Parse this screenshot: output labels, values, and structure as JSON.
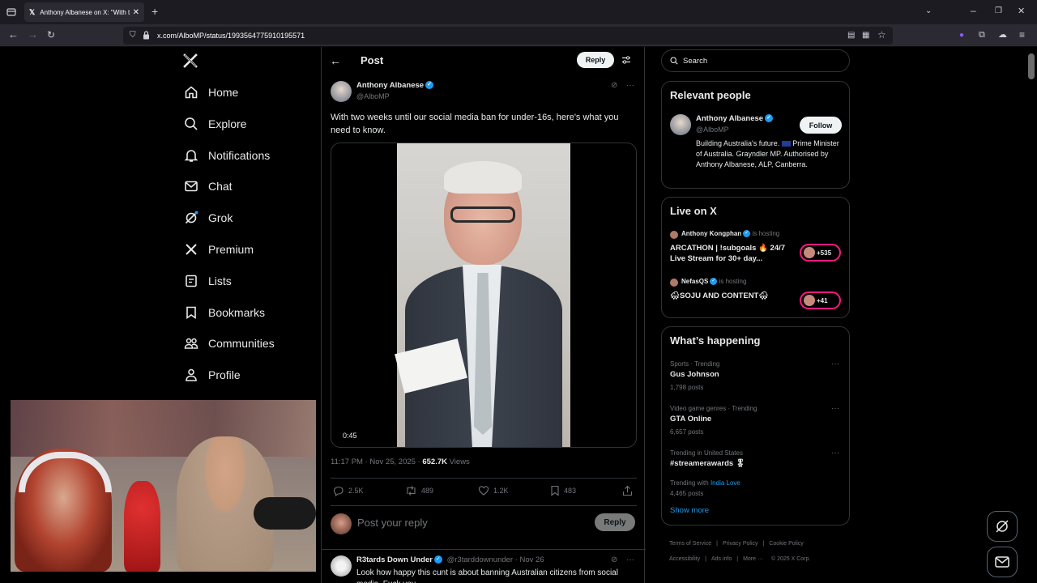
{
  "browser": {
    "tab_title": "Anthony Albanese on X: \"With t",
    "url": "x.com/AlboMP/status/1993564775910195571"
  },
  "nav": {
    "items": [
      {
        "label": "Home",
        "icon": "home-icon"
      },
      {
        "label": "Explore",
        "icon": "search-icon"
      },
      {
        "label": "Notifications",
        "icon": "bell-icon"
      },
      {
        "label": "Chat",
        "icon": "mail-icon"
      },
      {
        "label": "Grok",
        "icon": "grok-icon"
      },
      {
        "label": "Premium",
        "icon": "x-logo-icon"
      },
      {
        "label": "Lists",
        "icon": "list-icon"
      },
      {
        "label": "Bookmarks",
        "icon": "bookmark-icon"
      },
      {
        "label": "Communities",
        "icon": "communities-icon"
      },
      {
        "label": "Profile",
        "icon": "person-icon"
      }
    ]
  },
  "post": {
    "header_title": "Post",
    "reply_button": "Reply",
    "author_name": "Anthony Albanese",
    "author_handle": "@AlboMP",
    "text": "With two weeks until our social media ban for under-16s, here's what you need to know.",
    "video_time": "0:45",
    "timestamp": "11:17 PM · Nov 25, 2025 · ",
    "views_count": "652.7K",
    "views_label": " Views",
    "stats": {
      "replies": "2.5K",
      "reposts": "489",
      "likes": "1.2K",
      "bookmarks": "483"
    },
    "compose_placeholder": "Post your reply",
    "compose_button": "Reply"
  },
  "reply": {
    "name": "R3tards Down Under",
    "handle": "@r3tarddownunder · Nov 26",
    "text": "Look how happy this cunt is about banning Australian citizens from social media. Fuck you."
  },
  "sidebar": {
    "search_placeholder": "Search",
    "relevant": {
      "title": "Relevant people",
      "name": "Anthony Albanese",
      "handle": "@AlboMP",
      "follow": "Follow",
      "bio_a": "Building Australia's future. ",
      "bio_b": " Prime Minister of Australia. Grayndler MP. Authorised by Anthony Albanese, ALP, Canberra."
    },
    "live": {
      "title": "Live on X",
      "streams": [
        {
          "host": "Anthony Kongphan",
          "status": "is hosting",
          "title": "ARCATHON | !subgoals 🔥 24/7 Live Stream for 30+ day...",
          "count": "+535"
        },
        {
          "host": "NefasQS",
          "status": "is hosting",
          "title": "🌨SOJU AND CONTENT🌨",
          "count": "+41"
        }
      ]
    },
    "happening": {
      "title": "What’s happening",
      "trends": [
        {
          "meta": "Sports · Trending",
          "name": "Gus Johnson",
          "posts": "1,798 posts"
        },
        {
          "meta": "Video game genres · Trending",
          "name": "GTA Online",
          "posts": "6,657 posts"
        },
        {
          "meta": "Trending in United States",
          "name": "#streamerawards 🎖",
          "with_label": "Trending with ",
          "with_link": "India Love",
          "posts": "4,465 posts"
        }
      ],
      "show_more": "Show more"
    },
    "footer": [
      "Terms of Service",
      "Privacy Policy",
      "Cookie Policy",
      "Accessibility",
      "Ads info",
      "More ···",
      "© 2025 X Corp."
    ]
  },
  "colors": {
    "accent": "#1d9bf0",
    "background": "#000000",
    "border": "#2f3336",
    "muted": "#71767b",
    "live_ring": "#f91880"
  }
}
